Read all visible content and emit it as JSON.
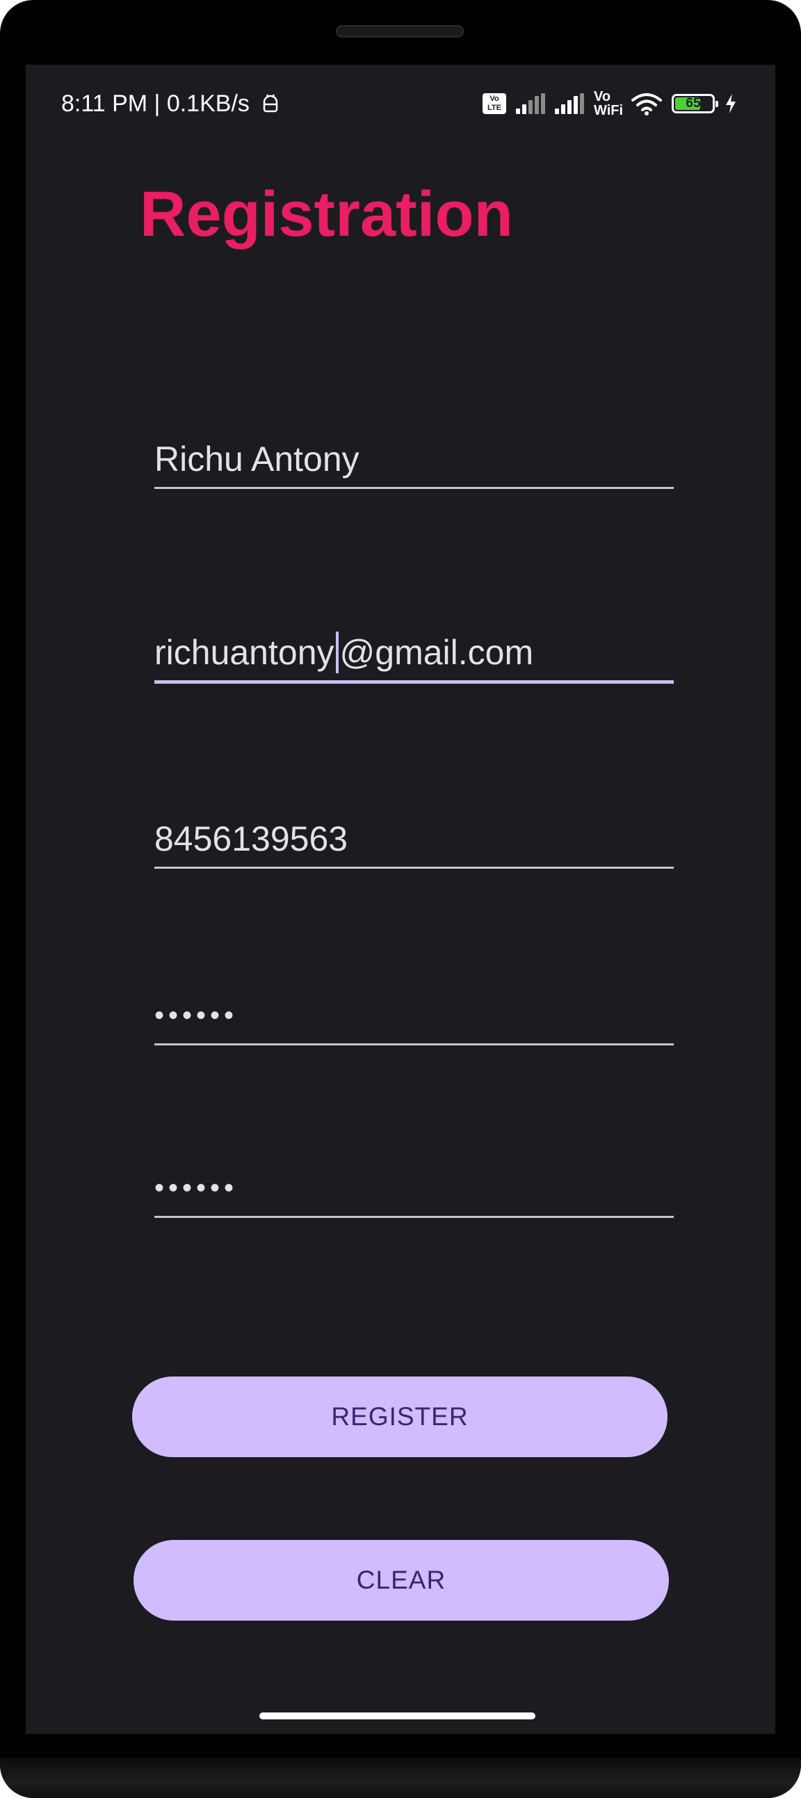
{
  "status_bar": {
    "time_speed": "8:11 PM | 0.1KB/s",
    "volte_label": "Vo LTE",
    "vowifi_label": "Vo WiFi",
    "battery_level": "65",
    "icons": [
      "android-icon",
      "volte-icon",
      "signal-icon",
      "signal-icon",
      "vowifi-icon",
      "wifi-icon",
      "battery-icon",
      "charging-icon"
    ]
  },
  "page": {
    "title": "Registration"
  },
  "form": {
    "name_value": "Richu Antony",
    "email_before_cursor": "richuantony",
    "email_after_cursor": "@gmail.com",
    "phone_value": "8456139563",
    "password_value": "••••••",
    "confirm_password_value": "••••••"
  },
  "buttons": {
    "register_label": "REGISTER",
    "clear_label": "CLEAR"
  },
  "colors": {
    "title": "#e91e63",
    "button_bg": "#d0bcff",
    "button_text": "#3a2472",
    "background": "#1c1b20"
  }
}
